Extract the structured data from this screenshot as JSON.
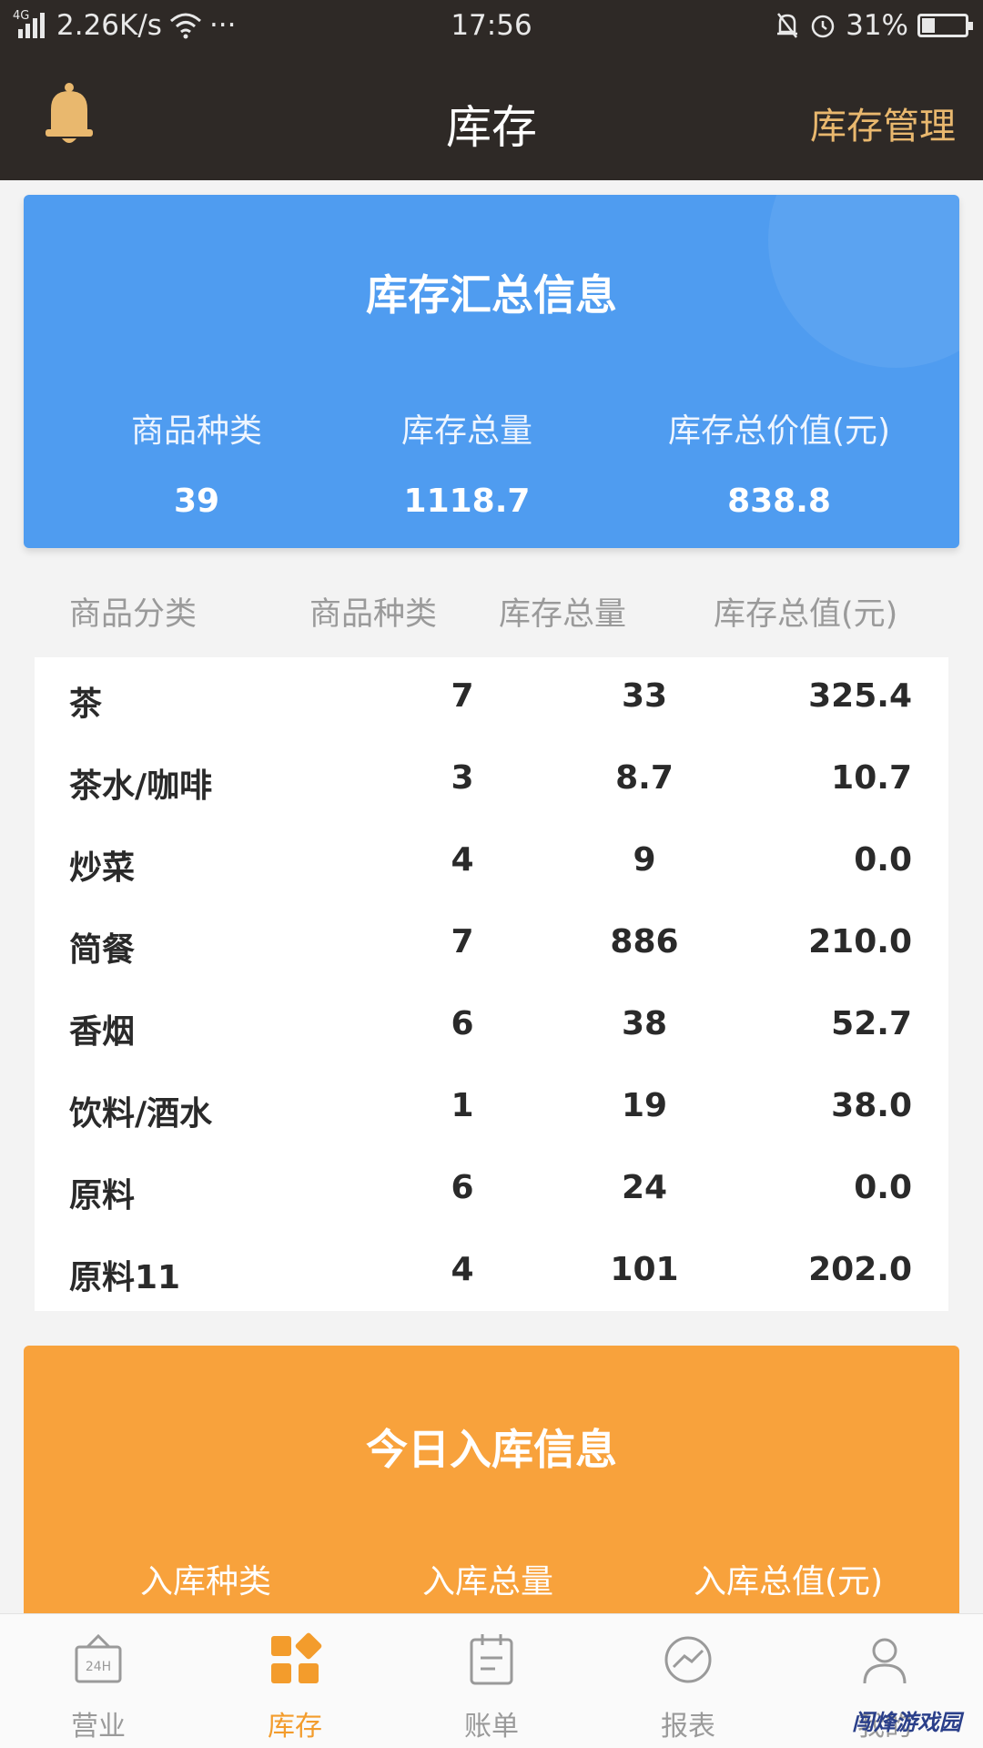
{
  "status_bar": {
    "network": "4G",
    "speed": "2.26K/s",
    "more": "···",
    "time": "17:56",
    "battery": "31%"
  },
  "header": {
    "title": "库存",
    "action": "库存管理",
    "icon": "bell-icon"
  },
  "summary": {
    "title": "库存汇总信息",
    "stats": [
      {
        "label": "商品种类",
        "value": "39"
      },
      {
        "label": "库存总量",
        "value": "1118.7"
      },
      {
        "label": "库存总价值(元)",
        "value": "838.8"
      }
    ]
  },
  "table": {
    "headers": [
      "商品分类",
      "商品种类",
      "库存总量",
      "库存总值(元)"
    ],
    "rows": [
      {
        "category": "茶",
        "kinds": "7",
        "qty": "33",
        "value": "325.4"
      },
      {
        "category": "茶水/咖啡",
        "kinds": "3",
        "qty": "8.7",
        "value": "10.7"
      },
      {
        "category": "炒菜",
        "kinds": "4",
        "qty": "9",
        "value": "0.0"
      },
      {
        "category": "简餐",
        "kinds": "7",
        "qty": "886",
        "value": "210.0"
      },
      {
        "category": "香烟",
        "kinds": "6",
        "qty": "38",
        "value": "52.7"
      },
      {
        "category": "饮料/酒水",
        "kinds": "1",
        "qty": "19",
        "value": "38.0"
      },
      {
        "category": "原料",
        "kinds": "6",
        "qty": "24",
        "value": "0.0"
      },
      {
        "category": "原料11",
        "kinds": "4",
        "qty": "101",
        "value": "202.0"
      }
    ]
  },
  "today": {
    "title": "今日入库信息",
    "labels": [
      "入库种类",
      "入库总量",
      "入库总值(元)"
    ]
  },
  "tabs": [
    {
      "label": "营业",
      "icon": "shop-24h-icon",
      "active": false
    },
    {
      "label": "库存",
      "icon": "inventory-grid-icon",
      "active": true
    },
    {
      "label": "账单",
      "icon": "bill-icon",
      "active": false
    },
    {
      "label": "报表",
      "icon": "report-icon",
      "active": false
    },
    {
      "label": "我的",
      "icon": "user-icon",
      "active": false
    }
  ],
  "watermark": "闯烽游戏园",
  "colors": {
    "header_bg": "#2e2926",
    "accent_gold": "#e9b86e",
    "summary_blue": "#4f9cf0",
    "today_orange": "#f8a23c",
    "tab_active": "#f39c2c"
  }
}
